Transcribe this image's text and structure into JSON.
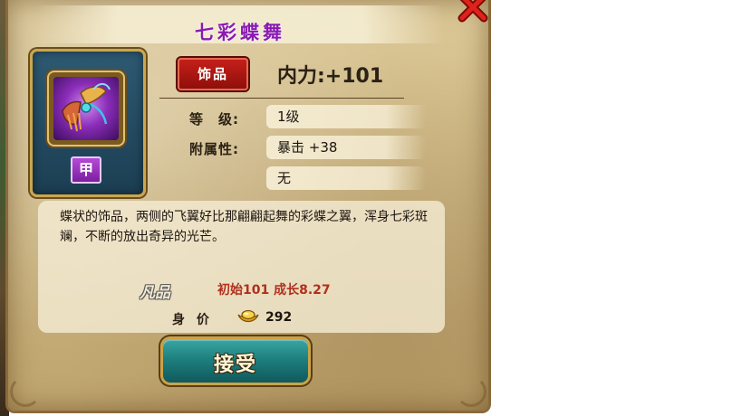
{
  "dialog": {
    "title": "七彩蝶舞",
    "close_icon": "close-x-icon",
    "title_color": "#8a1bb0"
  },
  "item": {
    "icon": "butterfly-ornament-icon",
    "grade_badge": "甲",
    "type_tag": "饰品",
    "main_stat": "内力:+101"
  },
  "attributes": {
    "level_label": "等　级:",
    "level_value": "1级",
    "bonus_label": "附属性:",
    "bonus_value_1": "暴击 +38",
    "bonus_value_2": "无"
  },
  "description": {
    "text": "蝶状的饰品，两侧的飞翼好比那翩翩起舞的彩蝶之翼，浑身七彩斑斓，不断的放出奇异的光芒。",
    "rarity": "凡品",
    "growth": "初始101  成长8.27",
    "price_label": "身 价",
    "price_icon": "gold-ingot-icon",
    "price_value": "292"
  },
  "actions": {
    "accept_label": "接受"
  },
  "colors": {
    "accent_red": "#b0301c",
    "button_teal": "#1c7c7c",
    "parchment": "#cdb784"
  }
}
